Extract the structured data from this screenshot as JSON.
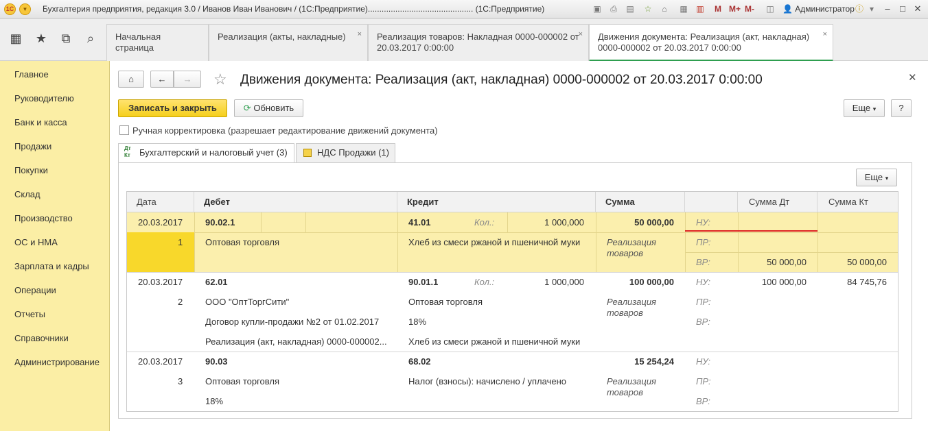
{
  "window": {
    "title": "Бухгалтерия предприятия, редакция 3.0 / Иванов Иван Иванович / (1С:Предприятие).............................................. (1С:Предприятие)",
    "logo_text": "1С",
    "user": "Администратор",
    "m_buttons": [
      "M",
      "M+",
      "M-"
    ]
  },
  "tabs": [
    {
      "label": "Начальная страница"
    },
    {
      "label": "Реализация (акты, накладные)"
    },
    {
      "label": "Реализация товаров: Накладная 0000-000002 от 20.03.2017 0:00:00"
    },
    {
      "label": "Движения документа: Реализация (акт, накладная) 0000-000002 от 20.03.2017 0:00:00"
    }
  ],
  "sidebar": {
    "items": [
      "Главное",
      "Руководителю",
      "Банк и касса",
      "Продажи",
      "Покупки",
      "Склад",
      "Производство",
      "ОС и НМА",
      "Зарплата и кадры",
      "Операции",
      "Отчеты",
      "Справочники",
      "Администрирование"
    ]
  },
  "form": {
    "title": "Движения документа: Реализация (акт, накладная) 0000-000002 от 20.03.2017 0:00:00",
    "save_close": "Записать и закрыть",
    "refresh": "Обновить",
    "more": "Еще",
    "help": "?",
    "manual_edit": "Ручная корректировка (разрешает редактирование движений документа)",
    "tab_accounting": "Бухгалтерский и налоговый учет (3)",
    "tab_vat": "НДС Продажи (1)",
    "dtkt_icon_text": "Дт Кт"
  },
  "table": {
    "more": "Еще",
    "headers": [
      "Дата",
      "Дебет",
      "Кредит",
      "Сумма",
      "",
      "Сумма Дт",
      "Сумма Кт"
    ],
    "labels": {
      "qty": "Кол.:",
      "nu": "НУ:",
      "pr": "ПР:",
      "vr": "ВР:"
    },
    "rows": [
      {
        "date": "20.03.2017",
        "num": "1",
        "debit": "90.02.1",
        "debit_lines": [
          "Оптовая торговля"
        ],
        "credit": "41.01",
        "credit_qty": "1 000,000",
        "credit_lines": [
          "Хлеб из смеси ржаной и пшеничной муки"
        ],
        "sum": "50 000,00",
        "content": "Реализация товаров",
        "nu_dt": "",
        "nu_kt": "",
        "vr_dt": "50 000,00",
        "vr_kt": "50 000,00"
      },
      {
        "date": "20.03.2017",
        "num": "2",
        "debit": "62.01",
        "debit_lines": [
          "ООО \"ОптТоргСити\"",
          "Договор купли-продажи №2 от 01.02.2017",
          "Реализация (акт, накладная) 0000-000002..."
        ],
        "credit": "90.01.1",
        "credit_qty": "1 000,000",
        "credit_lines": [
          "Оптовая торговля",
          "18%",
          "Хлеб из смеси ржаной и пшеничной муки"
        ],
        "sum": "100 000,00",
        "content": "Реализация товаров",
        "nu_dt": "100 000,00",
        "nu_kt": "84 745,76"
      },
      {
        "date": "20.03.2017",
        "num": "3",
        "debit": "90.03",
        "debit_lines": [
          "Оптовая торговля",
          "18%"
        ],
        "credit": "68.02",
        "credit_lines": [
          "Налог (взносы): начислено / уплачено"
        ],
        "sum": "15 254,24",
        "content": "Реализация товаров"
      }
    ]
  }
}
